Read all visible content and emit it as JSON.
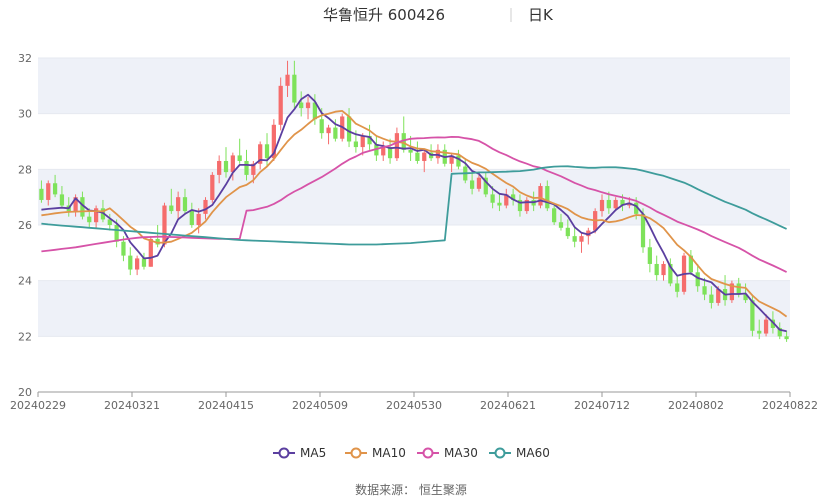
{
  "header": {
    "stock_name": "华鲁恒升 600426",
    "period": "日K"
  },
  "source": "数据来源： 恒生聚源",
  "colors": {
    "up": "#f56c6c",
    "down": "#7ee25a",
    "band": "#eef1f8",
    "axis": "#999999"
  },
  "chart_data": {
    "type": "candlestick",
    "title": "华鲁恒升 600426 日K",
    "ylim": [
      20,
      32
    ],
    "yticks": [
      20,
      22,
      24,
      26,
      28,
      30,
      32
    ],
    "x_tick_labels": [
      "20240229",
      "20240321",
      "20240415",
      "20240509",
      "20240530",
      "20240621",
      "20240712",
      "20240802",
      "20240822"
    ],
    "legend_position": "bottom",
    "ohlc": [
      [
        27.3,
        27.6,
        26.8,
        26.9
      ],
      [
        26.9,
        27.6,
        26.7,
        27.5
      ],
      [
        27.5,
        27.8,
        27.0,
        27.1
      ],
      [
        27.1,
        27.4,
        26.6,
        26.7
      ],
      [
        26.7,
        27.0,
        26.3,
        26.5
      ],
      [
        26.5,
        27.1,
        26.3,
        27.0
      ],
      [
        27.0,
        27.2,
        26.2,
        26.3
      ],
      [
        26.3,
        26.6,
        25.9,
        26.1
      ],
      [
        26.1,
        26.7,
        25.9,
        26.6
      ],
      [
        26.6,
        26.9,
        26.1,
        26.2
      ],
      [
        26.2,
        26.4,
        25.8,
        26.0
      ],
      [
        26.0,
        26.2,
        25.2,
        25.4
      ],
      [
        25.4,
        25.6,
        24.7,
        24.9
      ],
      [
        24.9,
        25.2,
        24.2,
        24.4
      ],
      [
        24.4,
        24.9,
        24.2,
        24.8
      ],
      [
        24.8,
        25.0,
        24.4,
        24.5
      ],
      [
        24.5,
        25.6,
        24.5,
        25.5
      ],
      [
        25.5,
        26.0,
        25.2,
        25.3
      ],
      [
        25.3,
        26.8,
        25.2,
        26.7
      ],
      [
        26.7,
        27.3,
        26.4,
        26.5
      ],
      [
        26.5,
        27.2,
        26.2,
        27.0
      ],
      [
        27.0,
        27.3,
        26.4,
        26.5
      ],
      [
        26.5,
        26.8,
        25.9,
        26.0
      ],
      [
        26.0,
        26.6,
        25.7,
        26.4
      ],
      [
        26.4,
        27.0,
        26.2,
        26.9
      ],
      [
        26.9,
        27.9,
        26.8,
        27.8
      ],
      [
        27.8,
        28.5,
        27.5,
        28.3
      ],
      [
        28.3,
        28.8,
        27.7,
        27.9
      ],
      [
        27.9,
        28.6,
        27.6,
        28.5
      ],
      [
        28.5,
        29.1,
        28.2,
        28.3
      ],
      [
        28.3,
        28.7,
        27.6,
        27.8
      ],
      [
        27.8,
        28.3,
        27.5,
        28.2
      ],
      [
        28.2,
        29.0,
        28.0,
        28.9
      ],
      [
        28.9,
        29.3,
        28.1,
        28.4
      ],
      [
        28.4,
        29.8,
        28.3,
        29.6
      ],
      [
        29.6,
        31.3,
        29.4,
        31.0
      ],
      [
        31.0,
        31.9,
        30.6,
        31.4
      ],
      [
        31.4,
        31.9,
        30.2,
        30.4
      ],
      [
        30.4,
        30.8,
        29.9,
        30.2
      ],
      [
        30.2,
        30.6,
        29.8,
        30.4
      ],
      [
        30.4,
        30.7,
        29.6,
        29.8
      ],
      [
        29.8,
        30.2,
        29.1,
        29.3
      ],
      [
        29.3,
        29.6,
        28.9,
        29.5
      ],
      [
        29.5,
        29.8,
        29.0,
        29.1
      ],
      [
        29.1,
        30.0,
        29.0,
        29.9
      ],
      [
        29.9,
        30.2,
        28.8,
        29.0
      ],
      [
        29.0,
        29.4,
        28.6,
        28.8
      ],
      [
        28.8,
        29.3,
        28.5,
        29.2
      ],
      [
        29.2,
        29.6,
        28.7,
        28.9
      ],
      [
        28.9,
        29.2,
        28.3,
        28.5
      ],
      [
        28.5,
        29.0,
        28.3,
        28.8
      ],
      [
        28.8,
        29.1,
        28.2,
        28.4
      ],
      [
        28.4,
        29.5,
        28.3,
        29.3
      ],
      [
        29.3,
        29.9,
        28.6,
        28.7
      ],
      [
        28.7,
        29.2,
        28.3,
        28.6
      ],
      [
        28.6,
        29.0,
        28.2,
        28.3
      ],
      [
        28.3,
        28.7,
        27.9,
        28.6
      ],
      [
        28.6,
        28.9,
        28.3,
        28.4
      ],
      [
        28.4,
        28.9,
        28.2,
        28.7
      ],
      [
        28.7,
        28.9,
        28.1,
        28.2
      ],
      [
        28.2,
        28.6,
        27.9,
        28.5
      ],
      [
        28.5,
        28.7,
        28.0,
        28.1
      ],
      [
        28.1,
        28.4,
        27.5,
        27.6
      ],
      [
        27.6,
        27.9,
        27.1,
        27.3
      ],
      [
        27.3,
        27.8,
        27.2,
        27.7
      ],
      [
        27.7,
        27.9,
        27.0,
        27.1
      ],
      [
        27.1,
        27.4,
        26.6,
        26.8
      ],
      [
        26.8,
        27.1,
        26.5,
        26.7
      ],
      [
        26.7,
        27.3,
        26.6,
        27.1
      ],
      [
        27.1,
        27.3,
        26.7,
        26.9
      ],
      [
        26.9,
        27.1,
        26.3,
        26.5
      ],
      [
        26.5,
        27.0,
        26.4,
        26.9
      ],
      [
        26.9,
        27.2,
        26.5,
        26.7
      ],
      [
        26.7,
        27.5,
        26.6,
        27.4
      ],
      [
        27.4,
        27.6,
        26.5,
        26.6
      ],
      [
        26.6,
        26.8,
        26.0,
        26.1
      ],
      [
        26.1,
        26.4,
        25.8,
        25.9
      ],
      [
        25.9,
        26.2,
        25.5,
        25.6
      ],
      [
        25.6,
        25.9,
        25.2,
        25.4
      ],
      [
        25.4,
        25.7,
        25.0,
        25.6
      ],
      [
        25.6,
        25.9,
        25.3,
        25.8
      ],
      [
        25.8,
        26.6,
        25.7,
        26.5
      ],
      [
        26.5,
        27.1,
        26.3,
        26.9
      ],
      [
        26.9,
        27.2,
        26.4,
        26.6
      ],
      [
        26.6,
        27.0,
        26.5,
        26.9
      ],
      [
        26.9,
        27.1,
        26.5,
        26.7
      ],
      [
        26.7,
        27.0,
        26.6,
        26.8
      ],
      [
        26.8,
        27.0,
        26.2,
        26.4
      ],
      [
        26.4,
        26.6,
        25.0,
        25.2
      ],
      [
        25.2,
        25.5,
        24.3,
        24.6
      ],
      [
        24.6,
        24.9,
        24.0,
        24.2
      ],
      [
        24.2,
        24.7,
        24.0,
        24.6
      ],
      [
        24.6,
        24.8,
        23.8,
        23.9
      ],
      [
        23.9,
        24.2,
        23.4,
        23.6
      ],
      [
        23.6,
        25.0,
        23.5,
        24.9
      ],
      [
        24.9,
        25.1,
        24.2,
        24.3
      ],
      [
        24.3,
        24.6,
        23.6,
        23.8
      ],
      [
        23.8,
        24.1,
        23.3,
        23.5
      ],
      [
        23.5,
        23.8,
        23.0,
        23.2
      ],
      [
        23.2,
        23.8,
        23.1,
        23.7
      ],
      [
        23.7,
        24.2,
        23.1,
        23.3
      ],
      [
        23.3,
        24.0,
        23.2,
        23.9
      ],
      [
        23.9,
        24.1,
        23.4,
        23.5
      ],
      [
        23.5,
        23.9,
        23.2,
        23.3
      ],
      [
        23.3,
        23.5,
        22.0,
        22.2
      ],
      [
        22.2,
        22.6,
        21.9,
        22.1
      ],
      [
        22.1,
        22.8,
        22.0,
        22.6
      ],
      [
        22.6,
        22.9,
        22.1,
        22.3
      ],
      [
        22.3,
        22.5,
        21.9,
        22.0
      ],
      [
        22.0,
        22.2,
        21.8,
        21.9
      ]
    ],
    "series": [
      {
        "name": "MA5",
        "color": "#5b3fa0",
        "period": 5,
        "lead": [
          26.55,
          26.58,
          26.6,
          26.62,
          26.6
        ]
      },
      {
        "name": "MA10",
        "color": "#e0944a",
        "period": 10,
        "lead": [
          26.35,
          26.38,
          26.42,
          26.45,
          26.47,
          26.48,
          26.49,
          26.5,
          26.5,
          26.49
        ]
      },
      {
        "name": "MA30",
        "color": "#d653a8",
        "period": 30,
        "lead": [
          25.05,
          25.08,
          25.11,
          25.14,
          25.17,
          25.2,
          25.24,
          25.28,
          25.32,
          25.36,
          25.4,
          25.44,
          25.48,
          25.51,
          25.54,
          25.56,
          25.57,
          25.58,
          25.58,
          25.57,
          25.56,
          25.55,
          25.54,
          25.53,
          25.52,
          25.51,
          25.5,
          25.5,
          25.5,
          25.5
        ]
      },
      {
        "name": "MA60",
        "color": "#3e9c9b",
        "period": 60,
        "lead": [
          26.05,
          26.02,
          26.0,
          25.98,
          25.96,
          25.94,
          25.92,
          25.9,
          25.88,
          25.86,
          25.84,
          25.82,
          25.8,
          25.78,
          25.76,
          25.74,
          25.72,
          25.7,
          25.68,
          25.66,
          25.64,
          25.62,
          25.6,
          25.58,
          25.56,
          25.54,
          25.52,
          25.5,
          25.48,
          25.46,
          25.45,
          25.44,
          25.43,
          25.42,
          25.41,
          25.4,
          25.39,
          25.38,
          25.37,
          25.36,
          25.35,
          25.34,
          25.33,
          25.32,
          25.31,
          25.3,
          25.3,
          25.3,
          25.3,
          25.3,
          25.31,
          25.32,
          25.33,
          25.34,
          25.35,
          25.37,
          25.39,
          25.41,
          25.43,
          25.45
        ]
      }
    ]
  }
}
